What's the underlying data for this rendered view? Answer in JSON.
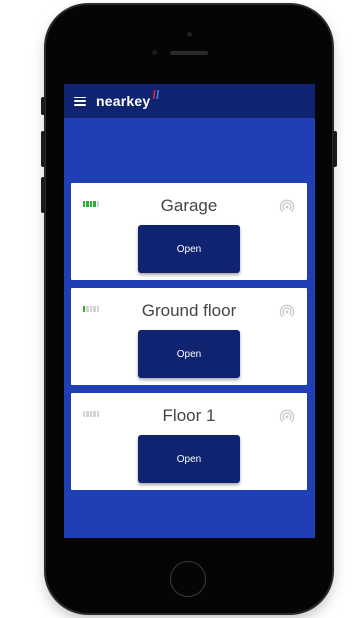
{
  "app": {
    "brand": "nearkey",
    "colors": {
      "screen_bg": "#1f3fb5",
      "appbar_bg": "#0f2370",
      "button_bg": "#0f2370",
      "signal_on": "#2fae3a",
      "signal_off": "#d4d4d4",
      "brand_mark_red": "#e8232b",
      "brand_mark_blue": "#3f7fe0"
    },
    "icons": {
      "menu": "hamburger-menu-icon",
      "signal": "signal-strength-icon",
      "nfc": "nfc-broadcast-icon"
    }
  },
  "doors": [
    {
      "name": "Garage",
      "button_label": "Open",
      "signal_bars_on": 4,
      "signal_bars_total": 5
    },
    {
      "name": "Ground floor",
      "button_label": "Open",
      "signal_bars_on": 1,
      "signal_bars_total": 5
    },
    {
      "name": "Floor 1",
      "button_label": "Open",
      "signal_bars_on": 0,
      "signal_bars_total": 5
    }
  ]
}
